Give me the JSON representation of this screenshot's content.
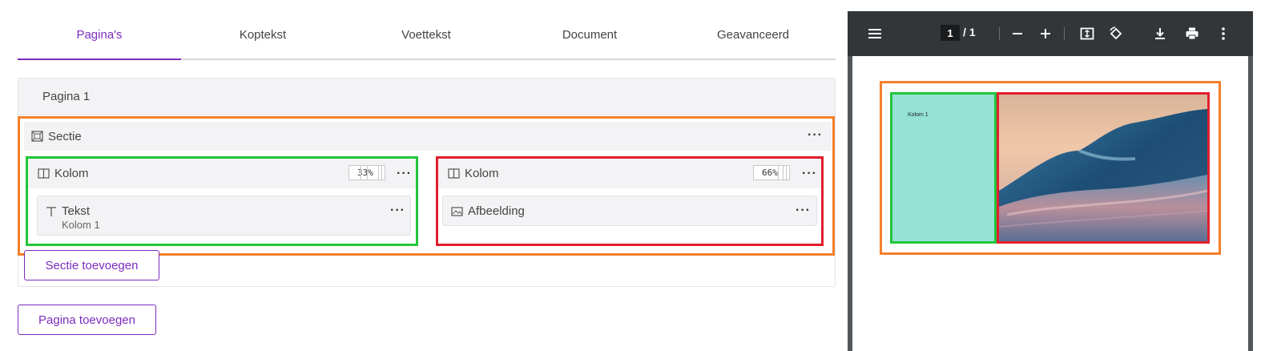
{
  "tabs": [
    {
      "label": "Pagina's",
      "active": true
    },
    {
      "label": "Koptekst"
    },
    {
      "label": "Voettekst"
    },
    {
      "label": "Document"
    },
    {
      "label": "Geavanceerd"
    }
  ],
  "page": {
    "title": "Pagina 1",
    "section": {
      "label": "Sectie",
      "columns": [
        {
          "label": "Kolom",
          "width": "33%",
          "block": {
            "title": "Tekst",
            "subtitle": "Kolom 1"
          }
        },
        {
          "label": "Kolom",
          "width": "66%",
          "block": {
            "title": "Afbeelding"
          }
        }
      ]
    },
    "add_section_label": "Sectie toevoegen"
  },
  "add_page_label": "Pagina toevoegen",
  "viewer": {
    "current_page": "1",
    "total_pages": "1",
    "preview_text": "Kolom 1"
  },
  "colors": {
    "accent": "#7b2cbf",
    "section_outline": "#f47f2a",
    "column1_outline": "#22c63a",
    "column2_outline": "#e21e2c",
    "preview_column_fill": "#95e3d5"
  }
}
